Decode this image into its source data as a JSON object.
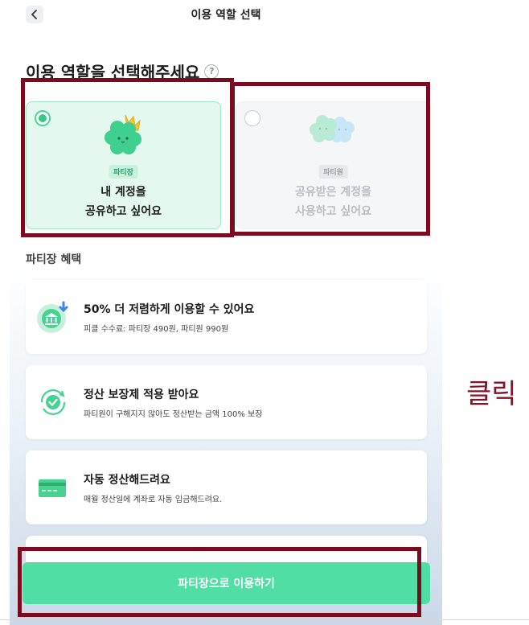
{
  "topbar": {
    "title": "이용 역할 선택",
    "back_icon": "chevron-left-icon"
  },
  "heading": {
    "text": "이용 역할을 선택해주세요",
    "help_icon": "question-circle-icon",
    "help_glyph": "?"
  },
  "roles": [
    {
      "badge": "파티장",
      "line1": "내 계정을",
      "line2": "공유하고 싶어요",
      "selected": true,
      "icon": "crowned-mascot-icon"
    },
    {
      "badge": "파티원",
      "line1": "공유받은 계정을",
      "line2": "사용하고 싶어요",
      "selected": false,
      "icon": "twin-mascot-icon"
    }
  ],
  "benefits_section": {
    "title": "파티장 혜택",
    "items": [
      {
        "title": "50% 더 저렴하게 이용할 수 있어요",
        "desc": "피클 수수료: 파티장 490원, 파티원 990원",
        "icon": "bank-discount-icon"
      },
      {
        "title": "정산 보장제 적용 받아요",
        "desc": "파티원이 구해지지 않아도 정산받는 금액 100% 보장",
        "icon": "refresh-check-icon"
      },
      {
        "title": "자동 정산해드려요",
        "desc": "매월 정산일에 계좌로 자동 입금해드려요.",
        "icon": "card-icon"
      }
    ]
  },
  "cta": {
    "label": "파티장으로 이용하기"
  },
  "annotation": {
    "label": "클릭"
  },
  "colors": {
    "accent": "#50dea5",
    "highlight": "#7b0c1f",
    "host_bg": "#e4f8ef"
  }
}
